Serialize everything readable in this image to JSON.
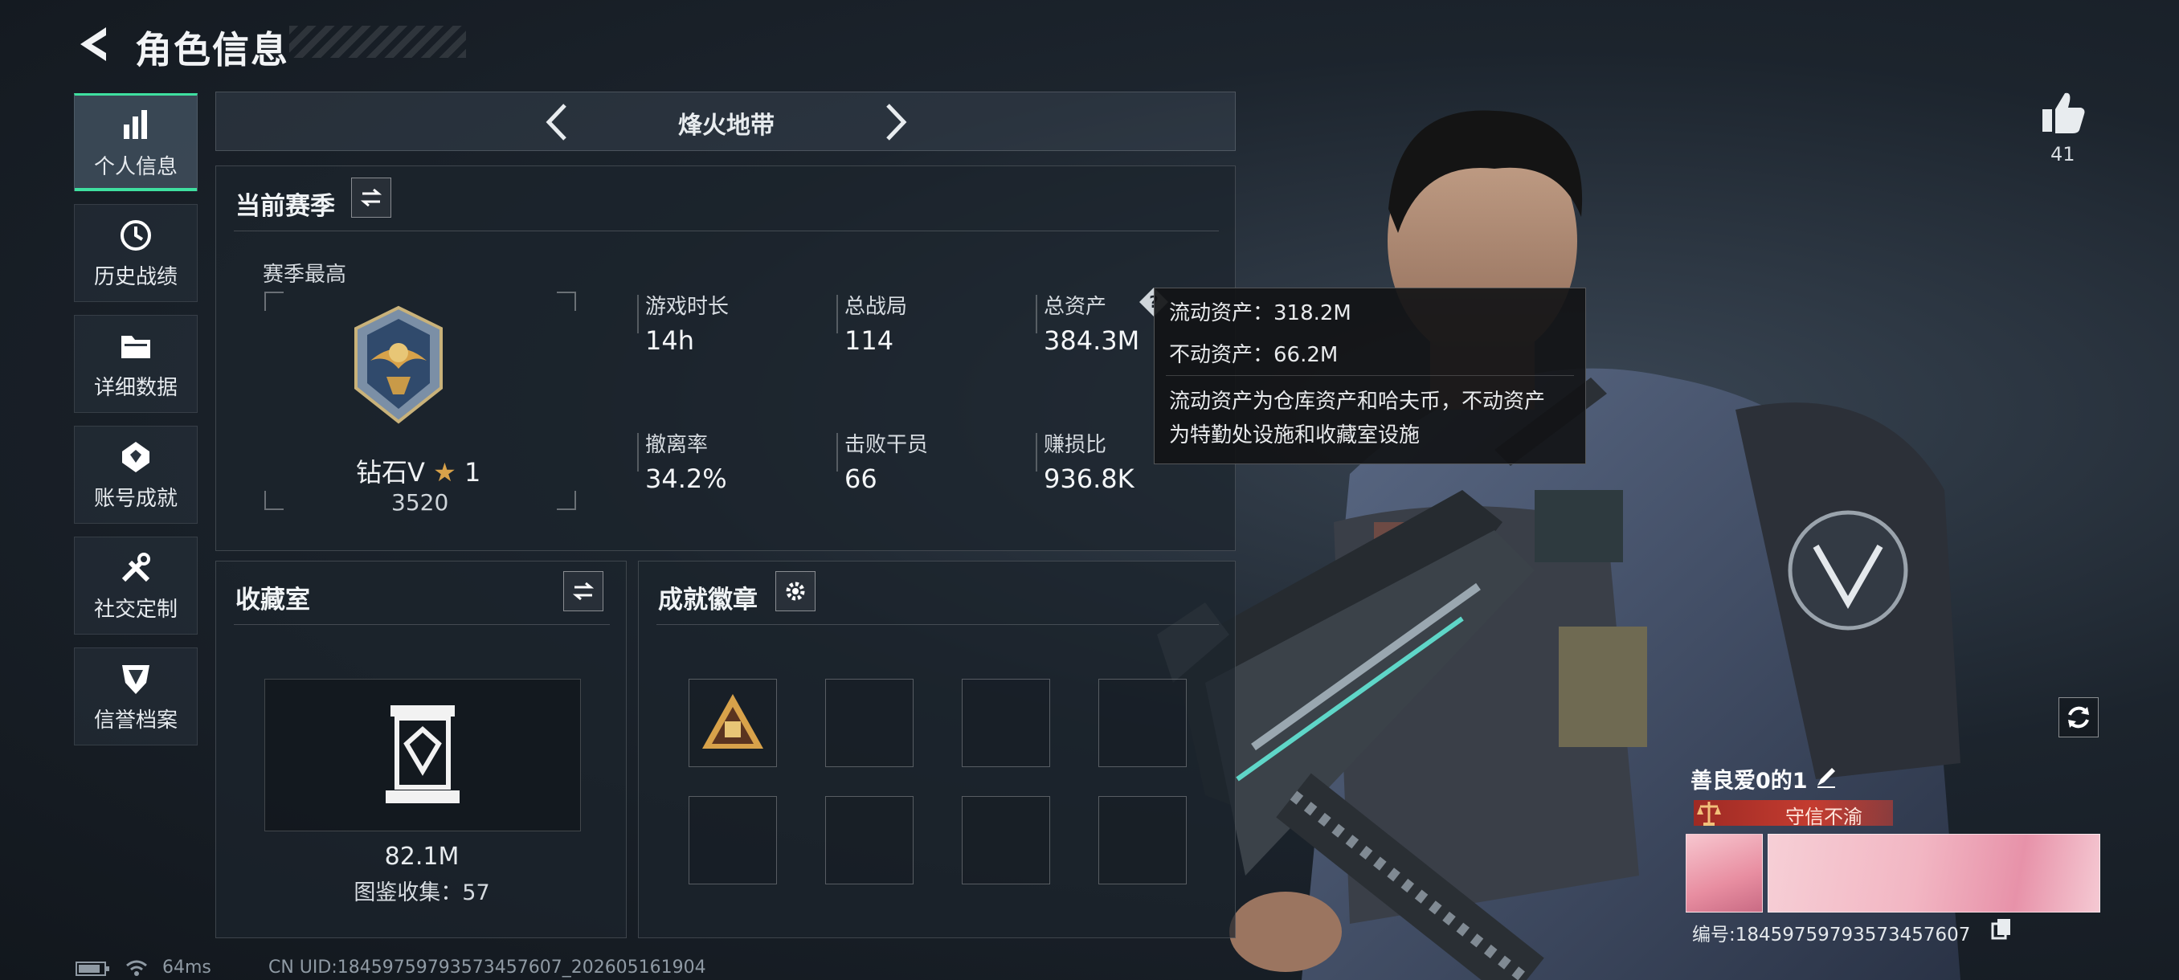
{
  "header": {
    "title": "角色信息"
  },
  "sidebar": {
    "items": [
      {
        "label": "个人信息",
        "icon": "bar-chart-icon",
        "active": true
      },
      {
        "label": "历史战绩",
        "icon": "history-clock-icon"
      },
      {
        "label": "详细数据",
        "icon": "folder-icon"
      },
      {
        "label": "账号成就",
        "icon": "achievement-icon"
      },
      {
        "label": "社交定制",
        "icon": "tools-icon"
      },
      {
        "label": "信誉档案",
        "icon": "reputation-shield-icon"
      }
    ]
  },
  "mode_selector": {
    "label": "烽火地带"
  },
  "season": {
    "title": "当前赛季",
    "best_label": "赛季最高",
    "rank_name": "钻石V",
    "rank_star_count": "1",
    "rank_score": "3520",
    "stats": [
      {
        "label": "游戏时长",
        "value": "14h"
      },
      {
        "label": "总战局",
        "value": "114"
      },
      {
        "label": "总资产",
        "value": "384.3M"
      },
      {
        "label": "撤离率",
        "value": "34.2%"
      },
      {
        "label": "击败干员",
        "value": "66"
      },
      {
        "label": "赚损比",
        "value": "936.8K"
      }
    ],
    "help_icon": "?"
  },
  "tooltip": {
    "liquid": "流动资产：318.2M",
    "fixed": "不动资产：66.2M",
    "desc_line1": "流动资产为仓库资产和哈夫币，不动资产",
    "desc_line2": "为特勤处设施和收藏室设施"
  },
  "collection": {
    "title": "收藏室",
    "value": "82.1M",
    "count_text": "图鉴收集：57"
  },
  "badges": {
    "title": "成就徽章",
    "slots": 8,
    "filled": 1
  },
  "profile": {
    "likes": "41",
    "name": "善良爱0的1",
    "honor_title": "守信不渝",
    "id_text": "编号:1845975979357345760​7"
  },
  "footer": {
    "ping": "64ms",
    "uid": "CN UID:1845975979357345760​7_202605161904"
  },
  "colors": {
    "accent": "#3fe0a0",
    "title_badge": "#c43c30",
    "gold": "#d8a24a"
  }
}
